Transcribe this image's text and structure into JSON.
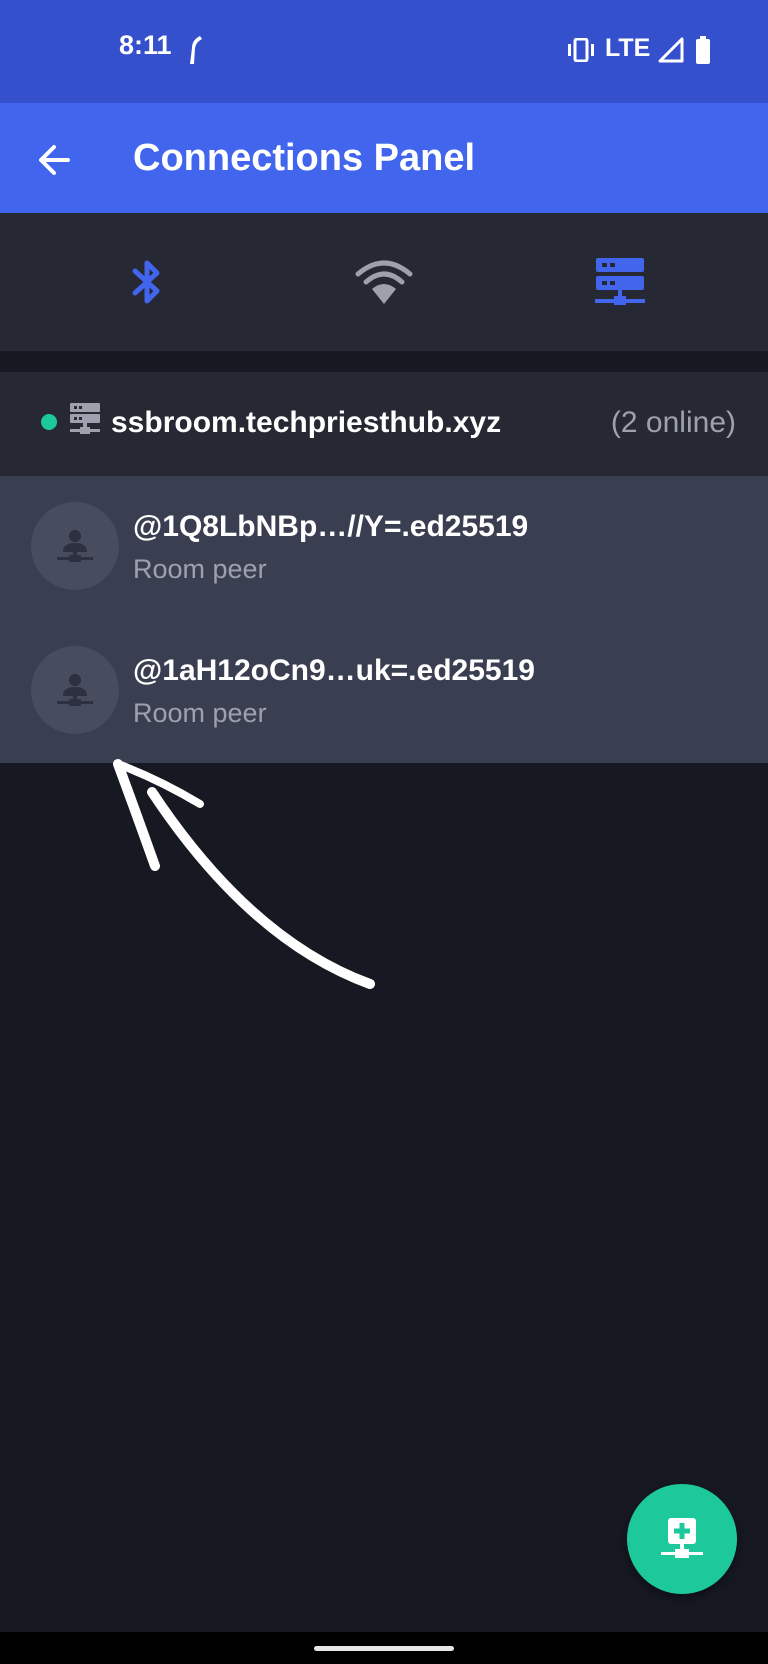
{
  "status_bar": {
    "time": "8:11",
    "network": "LTE",
    "icons": [
      "navigation-icon",
      "vibrate-icon",
      "signal-icon",
      "battery-icon"
    ]
  },
  "app_bar": {
    "title": "Connections Panel",
    "back_icon": "arrow-left-icon"
  },
  "tabs": [
    {
      "icon": "bluetooth-icon",
      "active": false,
      "color": "#4166ed"
    },
    {
      "icon": "wifi-icon",
      "active": false,
      "color": "#9ea1ad"
    },
    {
      "icon": "server-network-icon",
      "active": true,
      "color": "#4166ed"
    }
  ],
  "room": {
    "status_color": "#1dc99a",
    "name": "ssbroom.techpriesthub.xyz",
    "online": "(2 online)"
  },
  "peers": [
    {
      "id": "@1Q8LbNBp…//Y=.ed25519",
      "subtitle": "Room peer"
    },
    {
      "id": "@1aH12oCn9…uk=.ed25519",
      "subtitle": "Room peer"
    }
  ],
  "fab": {
    "icon": "add-connection-icon",
    "color": "#1dc99a"
  },
  "colors": {
    "background": "#171922",
    "status_bar": "#3550cc",
    "app_bar": "#4166ed",
    "panel": "#262934",
    "peer_list": "#3a3e51"
  }
}
